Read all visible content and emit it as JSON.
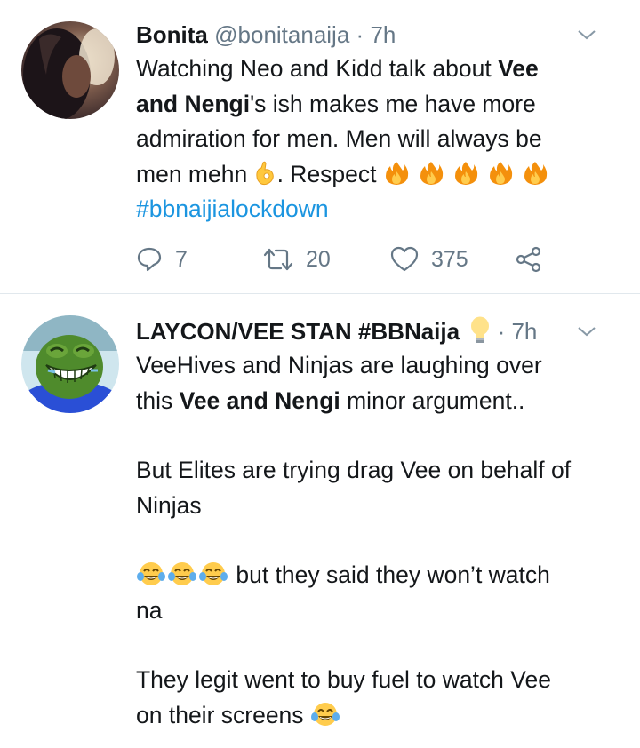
{
  "tweets": [
    {
      "author_name": "Bonita",
      "handle": "@bonitanaija",
      "separator": "·",
      "time": "7h",
      "lines": {
        "l1": "Watching Neo and Kidd talk about ",
        "l1b": "Vee",
        "l2b": "and Nengi",
        "l2": "'s ish makes me have more",
        "l3": "admiration for men. Men will always be",
        "l4a": "men mehn ",
        "l4b": ". Respect ",
        "hashtag": "#bbnaijialockdown"
      },
      "emojis": {
        "ok_hand": "ok-hand-emoji",
        "fire_count": 5,
        "fire": "fire-emoji"
      },
      "counts": {
        "replies": "7",
        "retweets": "20",
        "likes": "375"
      }
    },
    {
      "author_name": "LAYCON/VEE STAN #BBNaija",
      "separator": "·",
      "time": "7h",
      "lines": {
        "l1": "VeeHives and Ninjas are laughing over",
        "l2a": "this ",
        "l2b": "Vee and Nengi",
        "l2c": " minor argument..",
        "l3": "But Elites are trying drag Vee on behalf of",
        "l4": "Ninjas",
        "l5": " but they said they won’t watch",
        "l6": "na",
        "l7": "They legit went to buy fuel to watch Vee",
        "l8": "on their screens "
      },
      "emojis": {
        "bulb": "light-bulb-emoji",
        "joy": "tears-of-joy-emoji"
      }
    }
  ],
  "colors": {
    "text": "#14171a",
    "muted": "#657786",
    "link": "#1b95e0",
    "divider": "#e1e8ed"
  }
}
